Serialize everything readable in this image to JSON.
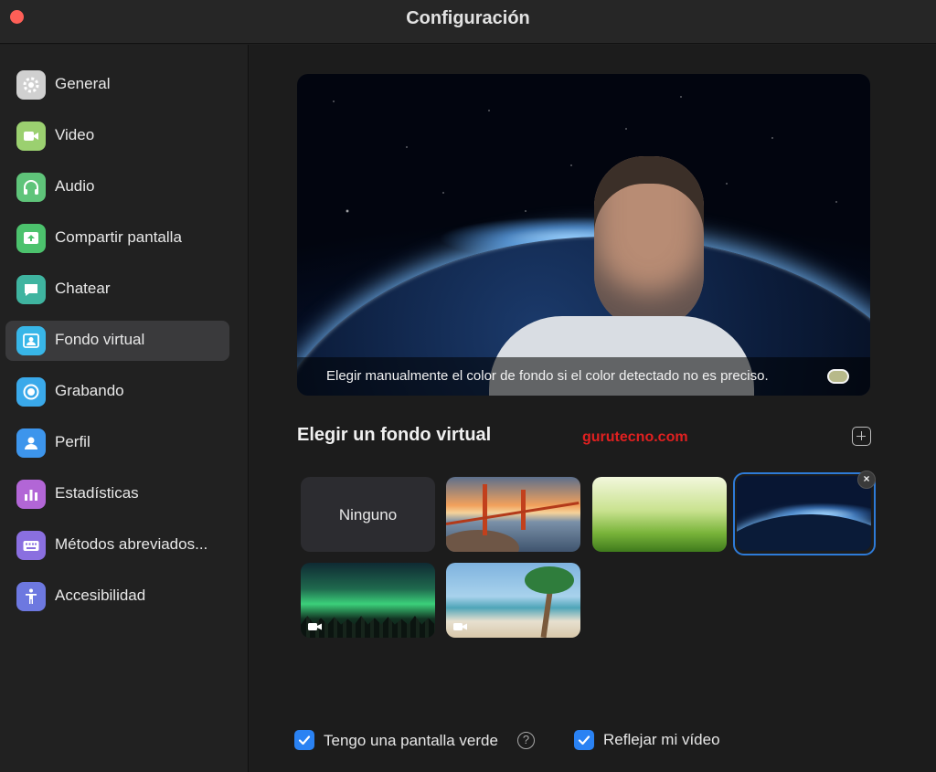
{
  "window": {
    "title": "Configuración"
  },
  "sidebar": {
    "items": [
      {
        "label": "General",
        "icon": "gear-icon",
        "color": "#d0d0d0"
      },
      {
        "label": "Video",
        "icon": "video-camera-icon",
        "color": "#9bd070"
      },
      {
        "label": "Audio",
        "icon": "headphones-icon",
        "color": "#5fc47a"
      },
      {
        "label": "Compartir pantalla",
        "icon": "share-screen-icon",
        "color": "#4cc26d"
      },
      {
        "label": "Chatear",
        "icon": "chat-bubble-icon",
        "color": "#3fb4a0"
      },
      {
        "label": "Fondo virtual",
        "icon": "virtual-background-icon",
        "color": "#38b6e8",
        "active": true
      },
      {
        "label": "Grabando",
        "icon": "record-icon",
        "color": "#3aa9ea"
      },
      {
        "label": "Perfil",
        "icon": "profile-icon",
        "color": "#3d95ec"
      },
      {
        "label": "Estadísticas",
        "icon": "statistics-icon",
        "color": "#b266d6"
      },
      {
        "label": "Métodos abreviados...",
        "icon": "keyboard-icon",
        "color": "#8a6fe0"
      },
      {
        "label": "Accesibilidad",
        "icon": "accessibility-icon",
        "color": "#6d78e0"
      }
    ]
  },
  "preview": {
    "hint": "Elegir manualmente el color de fondo si el color detectado no es preciso.",
    "detected_color": "#b7b98a"
  },
  "backgrounds": {
    "title": "Elegir un fondo virtual",
    "watermark": "gurutecno.com",
    "none_label": "Ninguno",
    "items": [
      {
        "name": "golden-gate-bridge"
      },
      {
        "name": "grass"
      },
      {
        "name": "earth-from-space",
        "selected": true
      },
      {
        "name": "northern-lights",
        "video": true
      },
      {
        "name": "tropical-beach",
        "video": true
      }
    ]
  },
  "options": {
    "green_screen_label": "Tengo una pantalla verde",
    "green_screen_checked": true,
    "mirror_label": "Reflejar mi vídeo",
    "mirror_checked": true,
    "help_glyph": "?"
  },
  "colors": {
    "accent": "#2a82f3",
    "selection": "#2e7bd8",
    "close": "#fe5f57"
  }
}
